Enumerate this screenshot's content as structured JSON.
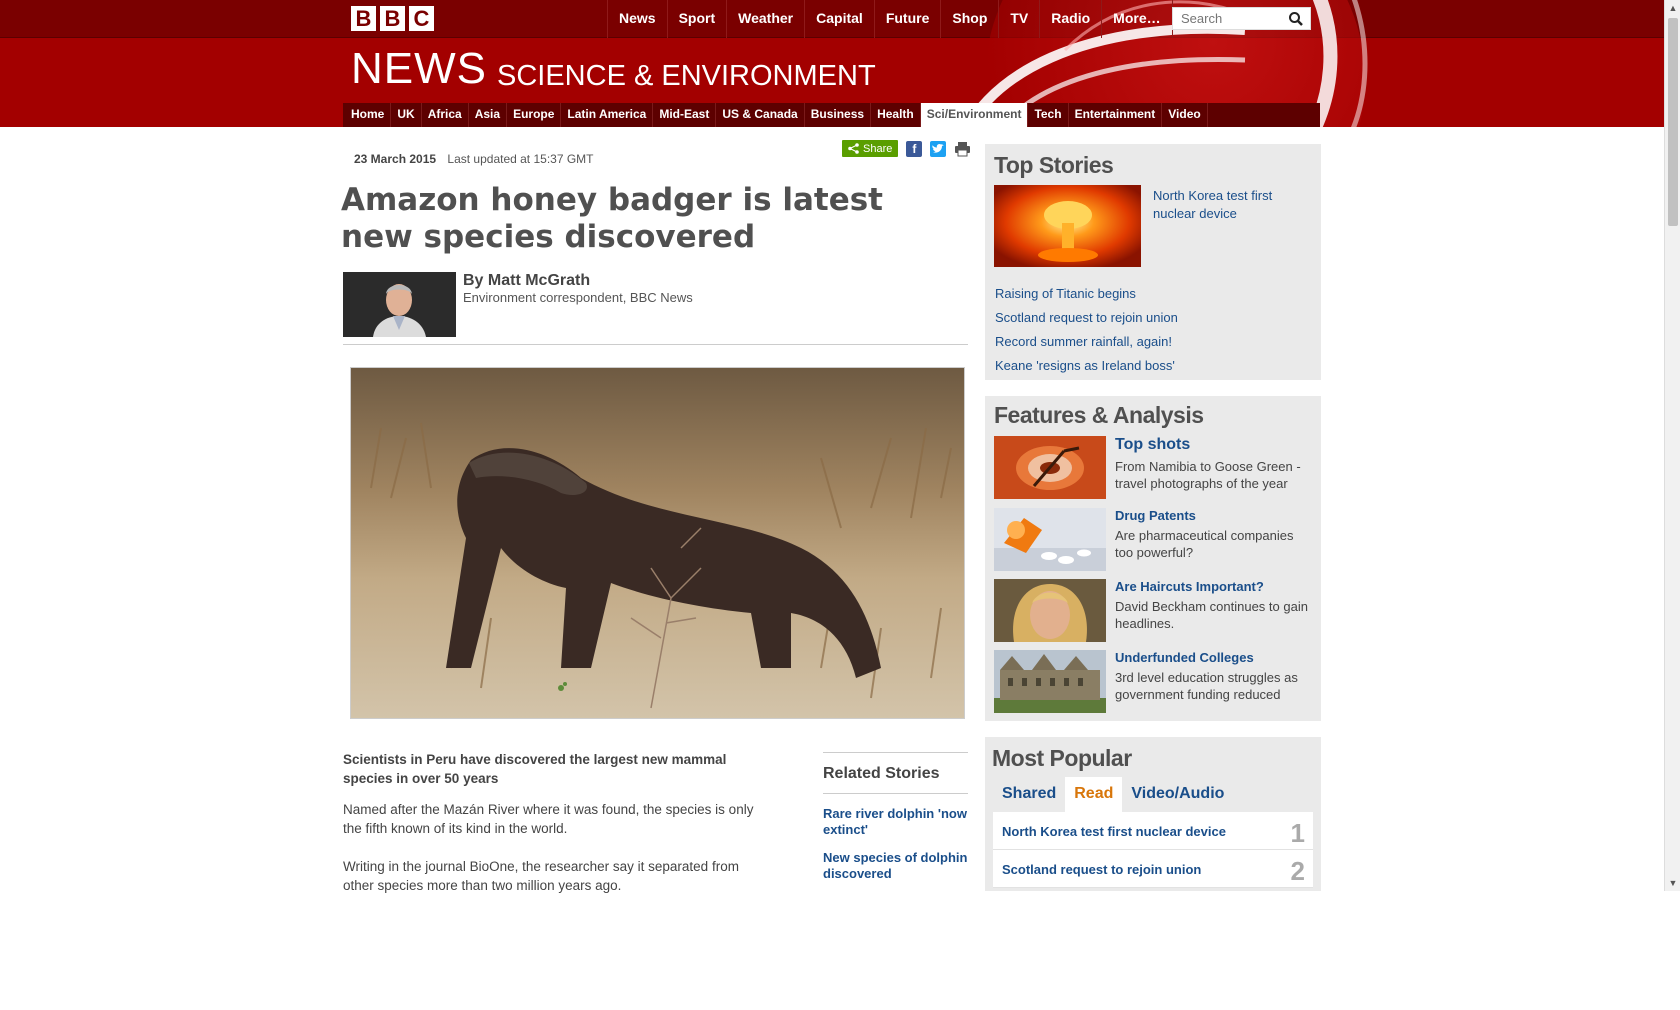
{
  "header": {
    "logo_letters": [
      "B",
      "B",
      "C"
    ],
    "nav": [
      "News",
      "Sport",
      "Weather",
      "Capital",
      "Future",
      "Shop",
      "TV",
      "Radio",
      "More…"
    ],
    "search_placeholder": "Search",
    "news": "NEWS",
    "section": "SCIENCE & ENVIRONMENT",
    "section_nav": [
      "Home",
      "UK",
      "Africa",
      "Asia",
      "Europe",
      "Latin America",
      "Mid-East",
      "US & Canada",
      "Business",
      "Health",
      "Sci/Environment",
      "Tech",
      "Entertainment",
      "Video"
    ],
    "active_section": "Sci/Environment",
    "colors": {
      "masthead": "#a30000",
      "topbar": "#7a0000",
      "link": "#1a4e8a",
      "active_tab": "#d8760a"
    }
  },
  "article": {
    "date": "23 March 2015",
    "updated": "Last updated at 15:37 GMT",
    "share_label": "Share",
    "headline": "Amazon honey badger is latest new species discovered",
    "author": "By Matt McGrath",
    "author_role": "Environment correspondent, BBC News",
    "intro": "Scientists in Peru have discovered the largest new mammal species in over 50 years",
    "paragraphs": [
      "Named after the Mazán River where it was found, the species is only the fifth known of its kind in the world.",
      "Writing in the journal BioOne, the researcher say it separated from other species more than two million years ago."
    ]
  },
  "related": {
    "title": "Related Stories",
    "links": [
      "Rare river dolphin 'now extinct'",
      "New species of dolphin discovered"
    ]
  },
  "top_stories": {
    "title": "Top Stories",
    "main": "North Korea test first nuclear device",
    "links": [
      "Raising of Titanic begins",
      "Scotland request to rejoin union",
      "Record summer rainfall, again!",
      "Keane 'resigns as Ireland boss'"
    ]
  },
  "features": {
    "title": "Features & Analysis",
    "items": [
      {
        "title": "Top shots",
        "desc": "From Namibia to Goose Green - travel photographs of the year"
      },
      {
        "title": "Drug Patents",
        "desc": "Are pharmaceutical companies too powerful?"
      },
      {
        "title": "Are Haircuts Important?",
        "desc": "David Beckham continues to gain headlines."
      },
      {
        "title": "Underfunded Colleges",
        "desc": "3rd level education struggles as government funding reduced"
      }
    ]
  },
  "popular": {
    "title": "Most Popular",
    "tabs": [
      "Shared",
      "Read",
      "Video/Audio"
    ],
    "active_tab": "Read",
    "items": [
      {
        "title": "North Korea test first nuclear device",
        "rank": "1"
      },
      {
        "title": "Scotland request to rejoin union",
        "rank": "2"
      }
    ]
  }
}
